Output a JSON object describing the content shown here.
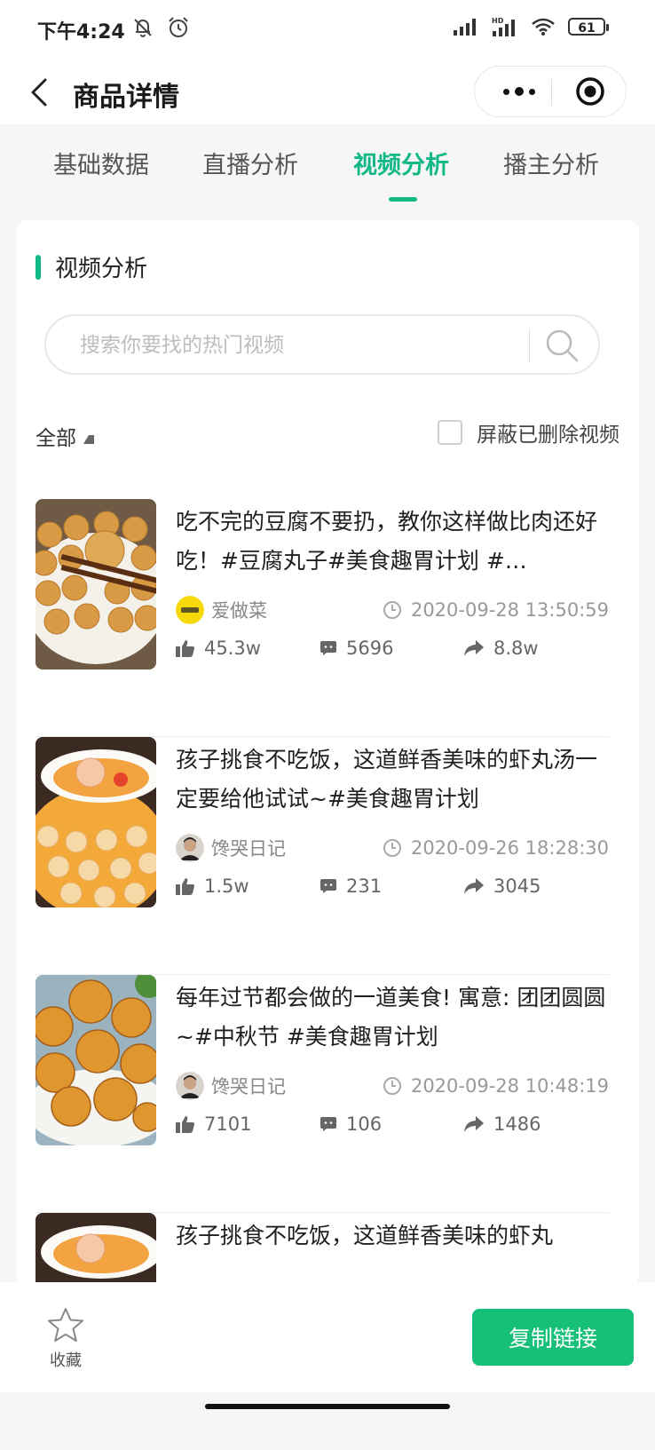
{
  "status_bar": {
    "time": "下午4:24",
    "battery": "61",
    "network_label": "HD"
  },
  "nav": {
    "title": "商品详情"
  },
  "tabs": [
    {
      "label": "基础数据"
    },
    {
      "label": "直播分析"
    },
    {
      "label": "视频分析"
    },
    {
      "label": "播主分析"
    }
  ],
  "section": {
    "title": "视频分析"
  },
  "search": {
    "placeholder": "搜索你要找的热门视频",
    "value": ""
  },
  "filter": {
    "label": "全部",
    "hide_deleted_label": "屏蔽已删除视频"
  },
  "videos": [
    {
      "title": "吃不完的豆腐不要扔，教你这样做比肉还好吃！#豆腐丸子#美食趣胃计划 #…",
      "author": "爱做菜",
      "time": "2020-09-28 13:50:59",
      "likes": "45.3w",
      "comments": "5696",
      "shares": "8.8w"
    },
    {
      "title": "孩子挑食不吃饭，这道鲜香美味的虾丸汤一定要给他试试~#美食趣胃计划",
      "author": "馋哭日记",
      "time": "2020-09-26 18:28:30",
      "likes": "1.5w",
      "comments": "231",
      "shares": "3045"
    },
    {
      "title": "每年过节都会做的一道美食! 寓意: 团团圆圆~#中秋节 #美食趣胃计划",
      "author": "馋哭日记",
      "time": "2020-09-28 10:48:19",
      "likes": "7101",
      "comments": "106",
      "shares": "1486"
    },
    {
      "title": "孩子挑食不吃饭，这道鲜香美味的虾丸"
    }
  ],
  "bottom": {
    "fav_label": "收藏",
    "copy_label": "复制链接"
  },
  "colors": {
    "accent": "#12b886",
    "button": "#16c079"
  }
}
